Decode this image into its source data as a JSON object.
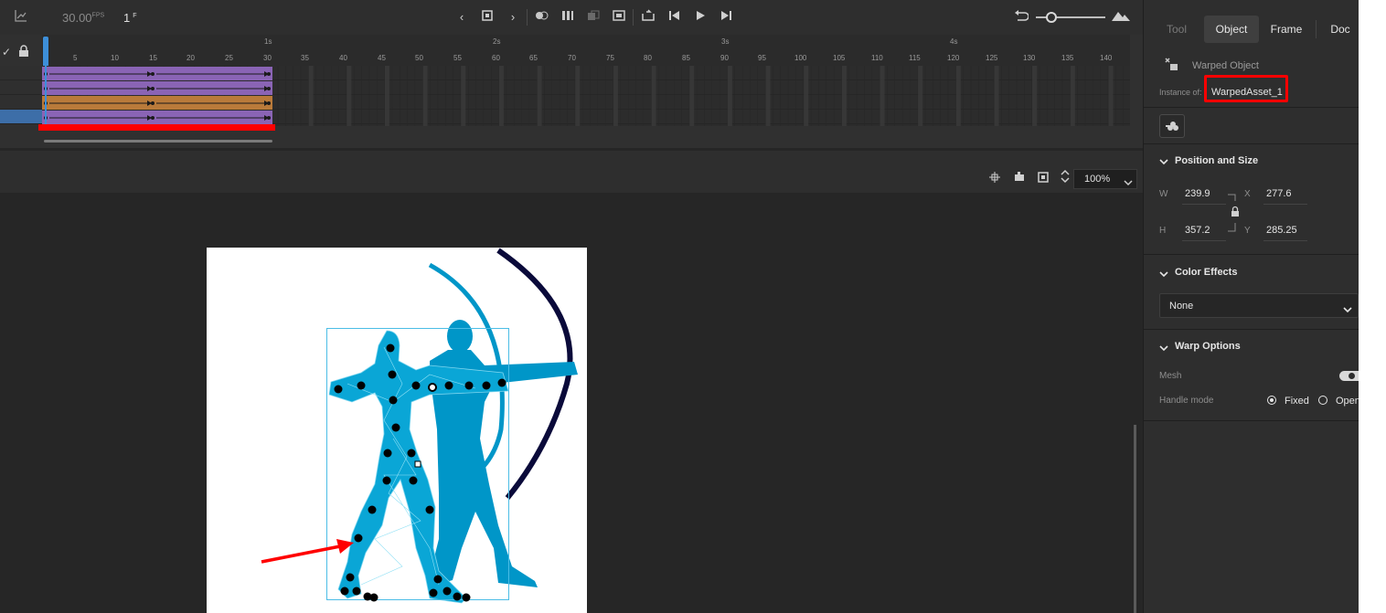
{
  "timeline": {
    "fps": "30.00",
    "fps_unit": "FPS",
    "current_frame": "1",
    "frame_unit": "F",
    "seconds": [
      "1s",
      "2s",
      "3s",
      "4s"
    ],
    "frame_numbers": [
      "5",
      "10",
      "15",
      "20",
      "25",
      "30",
      "35",
      "40",
      "45",
      "50",
      "55",
      "60",
      "65",
      "70",
      "75",
      "80",
      "85",
      "90",
      "95",
      "100",
      "105",
      "110",
      "115",
      "120",
      "125",
      "130",
      "135",
      "140"
    ],
    "layer_colors": [
      "#8a64b5",
      "#8a64b5",
      "#b97a3a",
      "#8a64b5"
    ],
    "icons": [
      "graph-icon",
      "prev-frame-icon",
      "stop-icon",
      "next-frame-icon",
      "onion-skin-icon",
      "edit-multiple-icon",
      "onion-outline-icon",
      "center-frame-icon",
      "loop-icon",
      "step-back-icon",
      "play-icon",
      "step-forward-icon",
      "undo-icon",
      "zoom-slider-icon",
      "mountain-icon"
    ]
  },
  "stage": {
    "zoom": "100%",
    "icons": [
      "snap-icon",
      "hand-rotate-icon",
      "fit-screen-icon",
      "zoom-stepper-icon",
      "chevron-down-icon"
    ]
  },
  "panel": {
    "tabs": [
      "Tool",
      "Object",
      "Frame",
      "Doc"
    ],
    "object_type": "Warped Object",
    "instance_label": "Instance of:",
    "instance_name": "WarpedAsset_1",
    "position_size": {
      "title": "Position and Size",
      "w_label": "W",
      "w": "239.9",
      "x_label": "X",
      "x": "277.6",
      "h_label": "H",
      "h": "357.2",
      "y_label": "Y",
      "y": "285.25"
    },
    "color_effects": {
      "title": "Color Effects",
      "value": "None"
    },
    "warp_options": {
      "title": "Warp Options",
      "mesh_label": "Mesh",
      "mesh_on": true,
      "handle_mode_label": "Handle mode",
      "fixed_label": "Fixed",
      "open_label": "Open"
    }
  },
  "colors": {
    "accent_red": "#ff0000",
    "figure_blue": "#0096c8",
    "bow_dark": "#0a0a3a",
    "playhead": "#3d8fd9"
  }
}
